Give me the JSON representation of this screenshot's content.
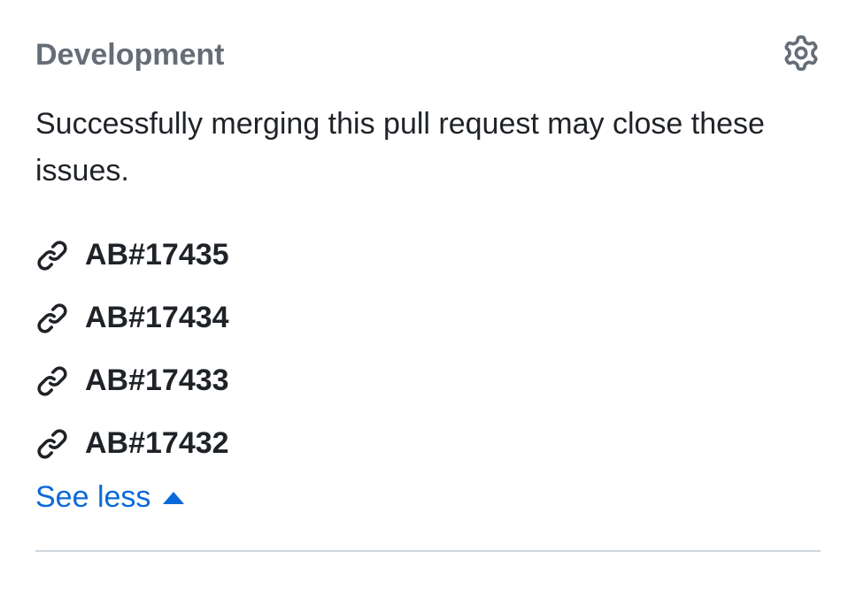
{
  "section": {
    "title": "Development",
    "description": "Successfully merging this pull request may close these issues."
  },
  "issues": [
    {
      "label": "AB#17435"
    },
    {
      "label": "AB#17434"
    },
    {
      "label": "AB#17433"
    },
    {
      "label": "AB#17432"
    }
  ],
  "toggle": {
    "label": "See less"
  }
}
